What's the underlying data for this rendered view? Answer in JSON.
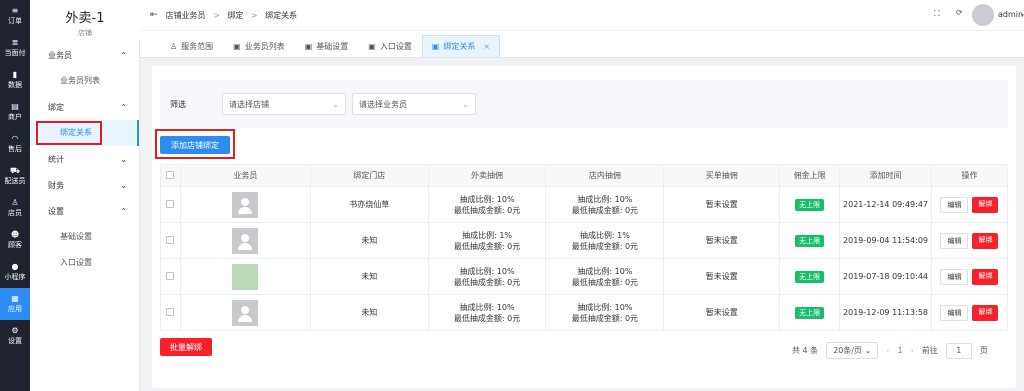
{
  "rail": [
    {
      "icon": "≡",
      "label": "订单",
      "icon_name": "list-icon"
    },
    {
      "icon": "≣",
      "label": "当面付",
      "icon_name": "menu-icon"
    },
    {
      "icon": "▮",
      "label": "数据",
      "icon_name": "chart-icon"
    },
    {
      "icon": "▤",
      "label": "商户",
      "icon_name": "store-icon"
    },
    {
      "icon": "◠",
      "label": "售后",
      "icon_name": "headset-icon"
    },
    {
      "icon": "⛟",
      "label": "配送员",
      "icon_name": "truck-icon"
    },
    {
      "icon": "♙",
      "label": "店员",
      "icon_name": "user-icon"
    },
    {
      "icon": "☻",
      "label": "顾客",
      "icon_name": "customer-icon"
    },
    {
      "icon": "●",
      "label": "小程序",
      "icon_name": "mini-program-icon"
    },
    {
      "icon": "▦",
      "label": "应用",
      "icon_name": "apps-icon"
    },
    {
      "icon": "⚙",
      "label": "设置",
      "icon_name": "gear-icon"
    }
  ],
  "shop": {
    "name": "外卖-1",
    "subtitle": "店铺"
  },
  "sidebar": {
    "g1": "业务员",
    "g1_item": "业务员列表",
    "g2": "绑定",
    "g2_item": "绑定关系",
    "g3": "统计",
    "g4": "财务",
    "g5": "设置",
    "g5_item1": "基础设置",
    "g5_item2": "入口设置"
  },
  "breadcrumb": {
    "b1": "店铺业务员",
    "b2": "绑定",
    "b3": "绑定关系",
    "sep": ">"
  },
  "user": {
    "name": "admin"
  },
  "tabs": [
    "服务范围",
    "业务员列表",
    "基础设置",
    "入口设置",
    "绑定关系"
  ],
  "filter": {
    "label": "筛选",
    "shop_placeholder": "请选择店铺",
    "staff_placeholder": "请选择业务员"
  },
  "add_button": "添加店铺绑定",
  "table": {
    "headers": [
      "业务员",
      "绑定门店",
      "外卖抽佣",
      "店内抽佣",
      "买单抽佣",
      "佣金上限",
      "添加时间",
      "操作"
    ],
    "rows": [
      {
        "store": "书亦烧仙草",
        "wm1": "抽成比例: 10%",
        "wm2": "最低抽成金额: 0元",
        "dn1": "抽成比例: 10%",
        "dn2": "最低抽成金额: 0元",
        "md": "暂未设置",
        "limit": "无上限",
        "time": "2021-12-14 09:49:47"
      },
      {
        "store": "未知",
        "wm1": "抽成比例: 1%",
        "wm2": "最低抽成金额: 0元",
        "dn1": "抽成比例: 1%",
        "dn2": "最低抽成金额: 0元",
        "md": "暂未设置",
        "limit": "无上限",
        "time": "2019-09-04 11:54:09"
      },
      {
        "store": "未知",
        "wm1": "抽成比例: 10%",
        "wm2": "最低抽成金额: 0元",
        "dn1": "抽成比例: 10%",
        "dn2": "最低抽成金额: 0元",
        "md": "暂未设置",
        "limit": "无上限",
        "time": "2019-07-18 09:10:44"
      },
      {
        "store": "未知",
        "wm1": "抽成比例: 10%",
        "wm2": "最低抽成金额: 0元",
        "dn1": "抽成比例: 10%",
        "dn2": "最低抽成金额: 0元",
        "md": "暂未设置",
        "limit": "无上限",
        "time": "2019-12-09 11:13:58"
      }
    ],
    "edit": "编辑",
    "unbind": "解绑"
  },
  "batch_unbind": "批量解绑",
  "pager": {
    "total": "共 4 条",
    "size": "20条/页",
    "page": "1",
    "goto": "前往",
    "goto_val": "1",
    "unit": "页"
  },
  "colors": {
    "accent": "#2d8cf0",
    "danger": "#f5222d",
    "success": "#19be6b",
    "rail": "#1f2430"
  }
}
